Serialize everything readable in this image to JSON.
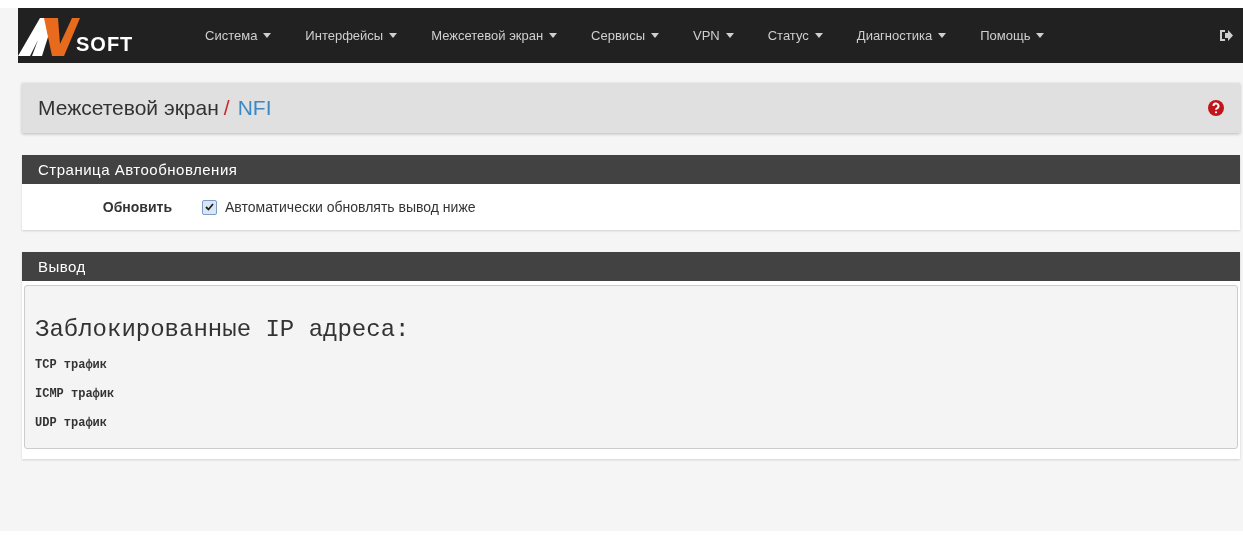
{
  "navbar": {
    "logo_text": "SOFT",
    "menu": [
      {
        "label": "Система"
      },
      {
        "label": "Интерфейсы"
      },
      {
        "label": "Межсетевой экран"
      },
      {
        "label": "Сервисы"
      },
      {
        "label": "VPN"
      },
      {
        "label": "Статус"
      },
      {
        "label": "Диагностика"
      },
      {
        "label": "Помощь"
      }
    ]
  },
  "breadcrumb": {
    "parent": "Межсетевой экран",
    "separator": "/",
    "current": "NFI"
  },
  "refresh_panel": {
    "title": "Страница Автообновления",
    "label": "Обновить",
    "checkbox": {
      "label": "Автоматически обновлять вывод ниже",
      "checked": true
    }
  },
  "output_panel": {
    "title": "Вывод",
    "lines": [
      {
        "kind": "heading",
        "text": "Заблокированные IP адреса:"
      },
      {
        "kind": "line",
        "text": "TCP трафик"
      },
      {
        "kind": "line",
        "text": "ICMP трафик"
      },
      {
        "kind": "line",
        "text": "UDP трафик"
      }
    ]
  }
}
